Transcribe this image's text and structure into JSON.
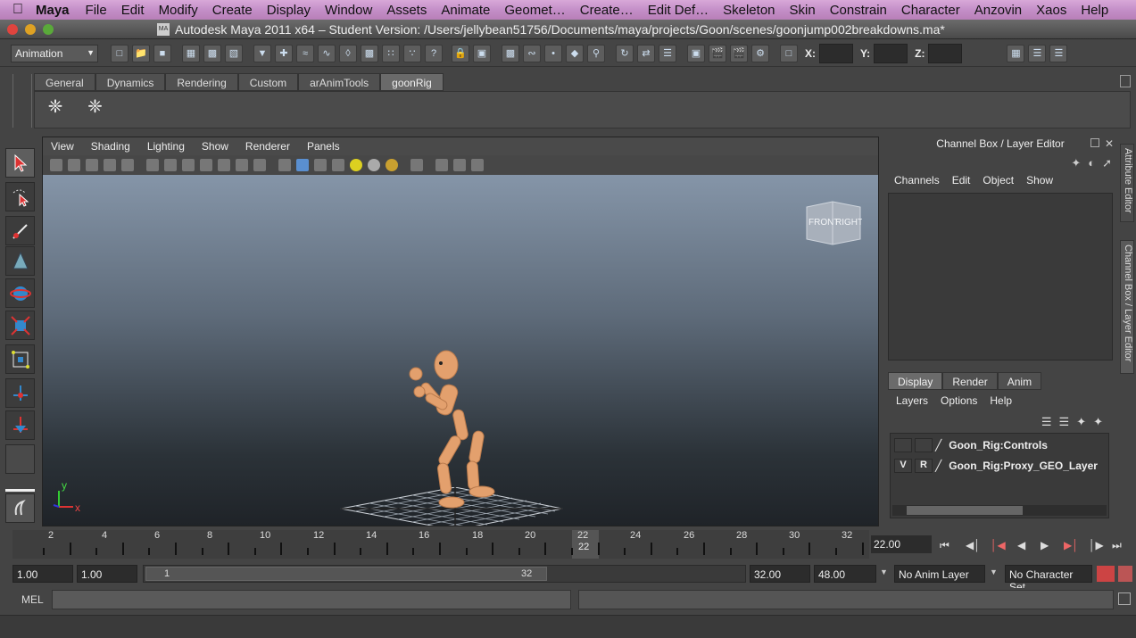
{
  "menubar": {
    "app": "Maya",
    "items": [
      "File",
      "Edit",
      "Modify",
      "Create",
      "Display",
      "Window",
      "Assets",
      "Animate",
      "Geomet…",
      "Create…",
      "Edit Def…",
      "Skeleton",
      "Skin",
      "Constrain",
      "Character",
      "Anzovin",
      "Xaos",
      "Help"
    ]
  },
  "titlebar": {
    "title": "Autodesk Maya 2011 x64 – Student Version: /Users/jellybean51756/Documents/maya/projects/Goon/scenes/goonjump002breakdowns.ma*"
  },
  "statusline": {
    "mode": "Animation",
    "x_label": "X:",
    "y_label": "Y:",
    "z_label": "Z:"
  },
  "shelf": {
    "tabs": [
      "General",
      "Dynamics",
      "Rendering",
      "Custom",
      "arAnimTools",
      "goonRig"
    ],
    "active_tab": "goonRig"
  },
  "viewport": {
    "menus": [
      "View",
      "Shading",
      "Lighting",
      "Show",
      "Renderer",
      "Panels"
    ],
    "viewcube_front": "FRONT",
    "viewcube_right": "RIGHT",
    "axis_x": "x",
    "axis_y": "y"
  },
  "channelbox": {
    "title": "Channel Box / Layer Editor",
    "menus": [
      "Channels",
      "Edit",
      "Object",
      "Show"
    ],
    "layer_tabs": [
      "Display",
      "Render",
      "Anim"
    ],
    "active_layer_tab": "Display",
    "layer_menus": [
      "Layers",
      "Options",
      "Help"
    ],
    "layers": [
      {
        "v": "",
        "r": "",
        "name": "Goon_Rig:Controls"
      },
      {
        "v": "V",
        "r": "R",
        "name": "Goon_Rig:Proxy_GEO_Layer"
      }
    ]
  },
  "sidetabs": {
    "attribute_editor": "Attribute Editor",
    "channel_box": "Channel Box / Layer Editor"
  },
  "timeslider": {
    "labels": [
      "2",
      "4",
      "6",
      "8",
      "10",
      "12",
      "14",
      "16",
      "18",
      "20",
      "22",
      "24",
      "26",
      "28",
      "30",
      "32"
    ],
    "current_frame_marker": "22",
    "current_time": "22.00"
  },
  "range": {
    "start_time": "1.00",
    "playback_start": "1.00",
    "range_start": "1",
    "range_end": "32",
    "playback_end": "32.00",
    "end_time": "48.00",
    "anim_layer": "No Anim Layer",
    "character_set": "No Character Set"
  },
  "cmdline": {
    "label": "MEL"
  }
}
